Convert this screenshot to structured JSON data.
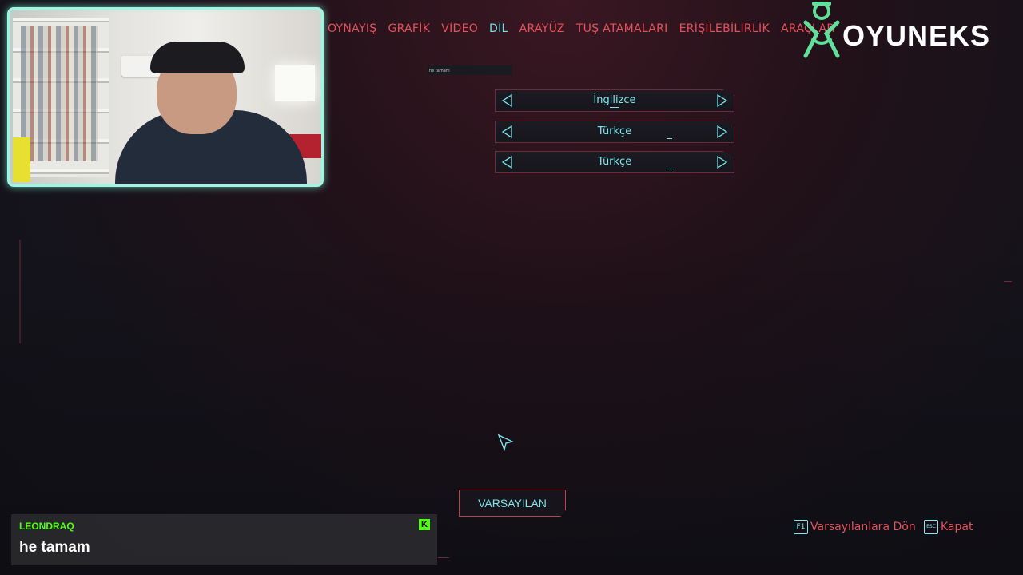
{
  "nav": {
    "items": [
      {
        "label": "OYNAYIŞ",
        "active": false
      },
      {
        "label": "GRAFİK",
        "active": false
      },
      {
        "label": "VİDEO",
        "active": false
      },
      {
        "label": "DİL",
        "active": true
      },
      {
        "label": "ARAYÜZ",
        "active": false
      },
      {
        "label": "TUŞ ATAMALARI",
        "active": false
      },
      {
        "label": "ERİŞİLEBİLİRLİK",
        "active": false
      },
      {
        "label": "ARAÇLAR",
        "active": false
      }
    ]
  },
  "brand": {
    "name": "OYUNEKS",
    "icon": "oyuneks-mascot-icon"
  },
  "tooltip": {
    "text": "he tamam"
  },
  "settings": {
    "selectors": [
      {
        "value": "İngilizce"
      },
      {
        "value": "Türkçe"
      },
      {
        "value": "Türkçe"
      }
    ]
  },
  "buttons": {
    "reset_label": "VARSAYILAN"
  },
  "hints": {
    "defaults": {
      "key": "F1",
      "label": "Varsayılanlara Dön"
    },
    "close": {
      "key": "ESC",
      "label": "Kapat"
    }
  },
  "chat": {
    "username": "LEONDRAQ",
    "message": "he tamam",
    "platform_icon": "K"
  },
  "colors": {
    "accent_cyan": "#7ee6ee",
    "accent_red": "#e8505c",
    "chat_green": "#53fc18"
  }
}
